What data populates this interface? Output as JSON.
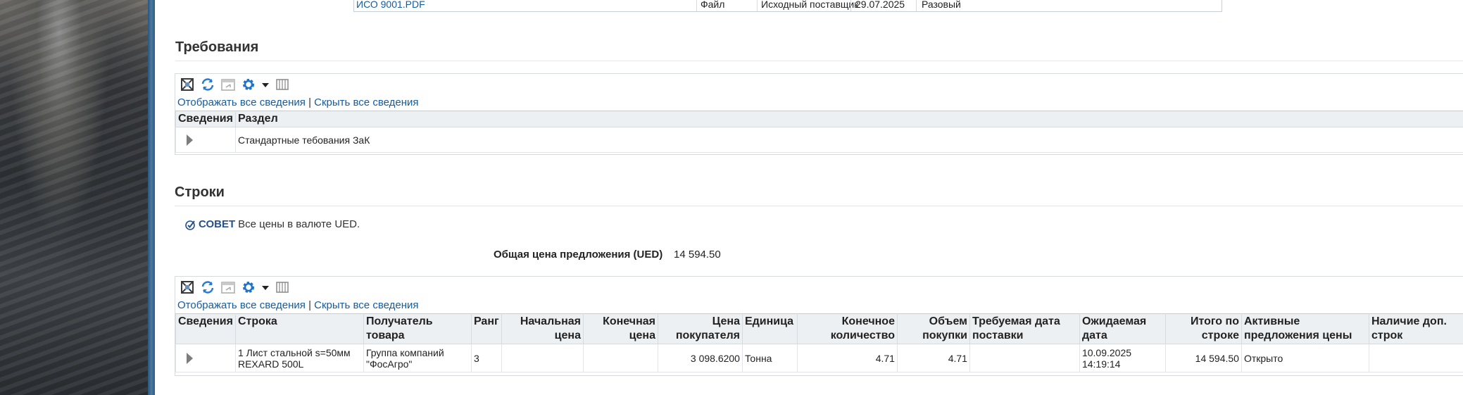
{
  "attachments": {
    "row": {
      "name": "ИСО 9001.PDF",
      "type": "Файл",
      "source": "Исходный поставщик",
      "date": "29.07.2025",
      "usage": "Разовый"
    }
  },
  "requirements": {
    "title": "Требования",
    "show_all": "Отображать все сведения",
    "link_sep": "|",
    "hide_all": "Скрыть все сведения",
    "columns": [
      "Сведения",
      "Раздел"
    ],
    "rows": [
      {
        "section": "Стандартные тебования ЗаК"
      }
    ]
  },
  "lines": {
    "title": "Строки",
    "tip_label": "СОВЕТ",
    "tip_text": "Все цены в валюте UED.",
    "total_label": "Общая цена предложения (UED)",
    "total_value": "14 594.50",
    "show_all": "Отображать все сведения",
    "link_sep": "|",
    "hide_all": "Скрыть все сведения",
    "columns": {
      "details": "Сведения",
      "line": "Строка",
      "recipient": "Получатель товара",
      "rank": "Ранг",
      "start_price": "Начальная цена",
      "end_price": "Конечная цена",
      "buyer_price": "Цена покупателя",
      "unit": "Единица",
      "end_qty": "Конечное количество",
      "purchase_qty": "Объем покупки",
      "required_date": "Требуемая дата поставки",
      "expected_date": "Ожидаемая дата",
      "line_total": "Итого по строке",
      "active_offers": "Активные предложения цены",
      "extra_lines": "Наличие доп. строк"
    },
    "rows": [
      {
        "line": "1 Лист стальной s=50мм REXARD 500L",
        "recipient": "Группа компаний \"ФосАгро\"",
        "rank": "3",
        "start_price": "",
        "end_price": "",
        "buyer_price": "3 098.6200",
        "unit": "Тонна",
        "end_qty": "4.71",
        "purchase_qty": "4.71",
        "required_date": "",
        "expected_date": "10.09.2025 14:19:14",
        "line_total": "14 594.50",
        "active_offers": "Открыто",
        "extra_lines": ""
      }
    ]
  },
  "icons": [
    "detach-icon",
    "refresh-icon",
    "freeze-icon",
    "settings-icon",
    "dropdown-arrow-icon",
    "columns-icon",
    "tip-icon",
    "expand-icon"
  ],
  "colors": {
    "link": "#145c9e",
    "header_bg": "#edf0f3",
    "divider": "#3d6a93",
    "tip": "#24508c"
  }
}
